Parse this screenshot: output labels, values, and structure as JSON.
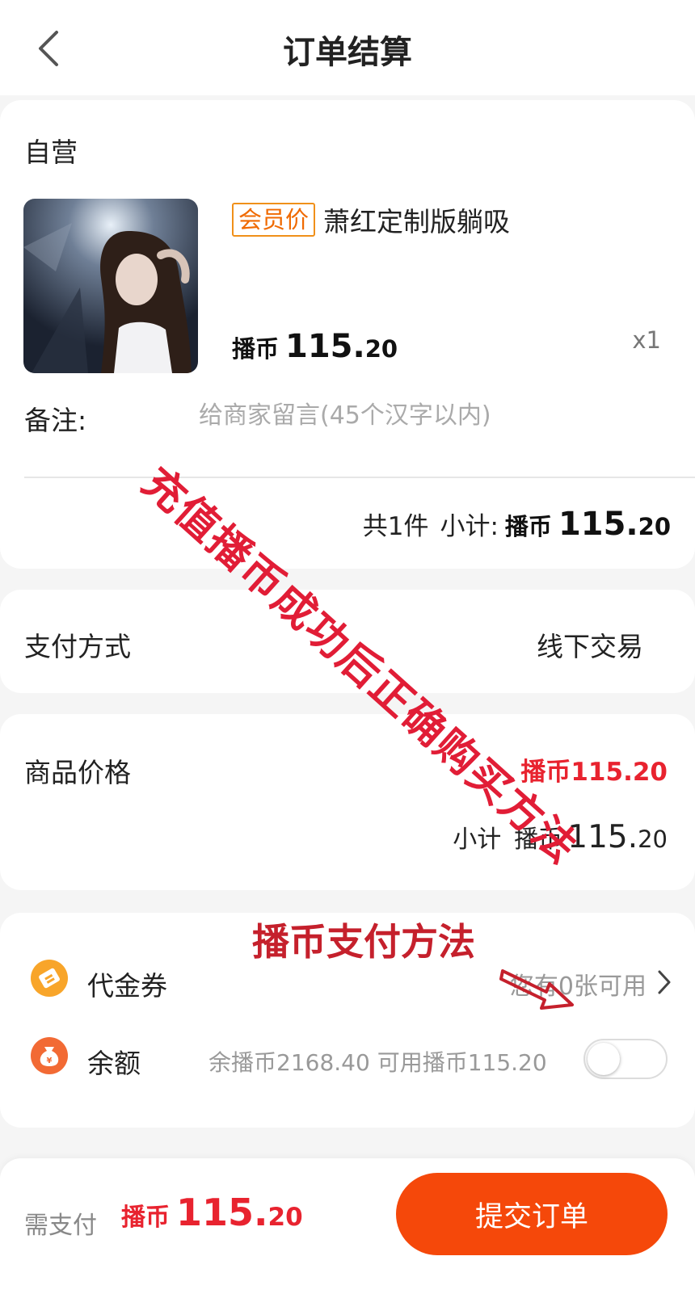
{
  "header": {
    "title": "订单结算"
  },
  "product_card": {
    "shop_name": "自营",
    "product": {
      "badge": "会员价",
      "title": "萧红定制版躺吸",
      "price_prefix": "播币",
      "price_int": "115.",
      "price_dec": "20",
      "quantity": "x1"
    },
    "remark": {
      "label": "备注:",
      "placeholder": "给商家留言(45个汉字以内)",
      "value": ""
    },
    "summary": {
      "count_text": "共1件",
      "subtotal_label": "小计:",
      "prefix": "播币",
      "amount_int": "115.",
      "amount_dec": "20"
    }
  },
  "payment_method": {
    "label": "支付方式",
    "value": "线下交易"
  },
  "price_card": {
    "goods_price_label": "商品价格",
    "goods_price_value": "播币115.20",
    "subtotal_label": "小计",
    "subtotal_prefix": "播币",
    "subtotal_int": "115.",
    "subtotal_dec": "20"
  },
  "assets": {
    "coupon": {
      "label": "代金券",
      "status": "您有0张可用"
    },
    "balance": {
      "label": "余额",
      "info": "余播币2168.40 可用播币115.20",
      "toggle_on": false
    }
  },
  "bottom_bar": {
    "pay_label": "需支付",
    "pay_prefix": "播币",
    "pay_int": "115.",
    "pay_dec": "20",
    "submit_label": "提交订单"
  },
  "overlay": {
    "diagonal_text": "充值播币成功后正确购买方法",
    "heading_text": "播币支付方法"
  },
  "colors": {
    "accent_orange": "#f5480a",
    "price_red": "#e8232f",
    "badge_orange": "#f0901a",
    "coupon_icon": "#f8a52a",
    "balance_icon": "#f26a34",
    "overlay_red": "#e11d36"
  },
  "icons": {
    "back": "chevron-left-icon",
    "coupon": "ticket-icon",
    "balance": "money-bag-icon",
    "coupon_chevron": "chevron-right-icon",
    "overlay_arrow": "arrow-icon"
  }
}
